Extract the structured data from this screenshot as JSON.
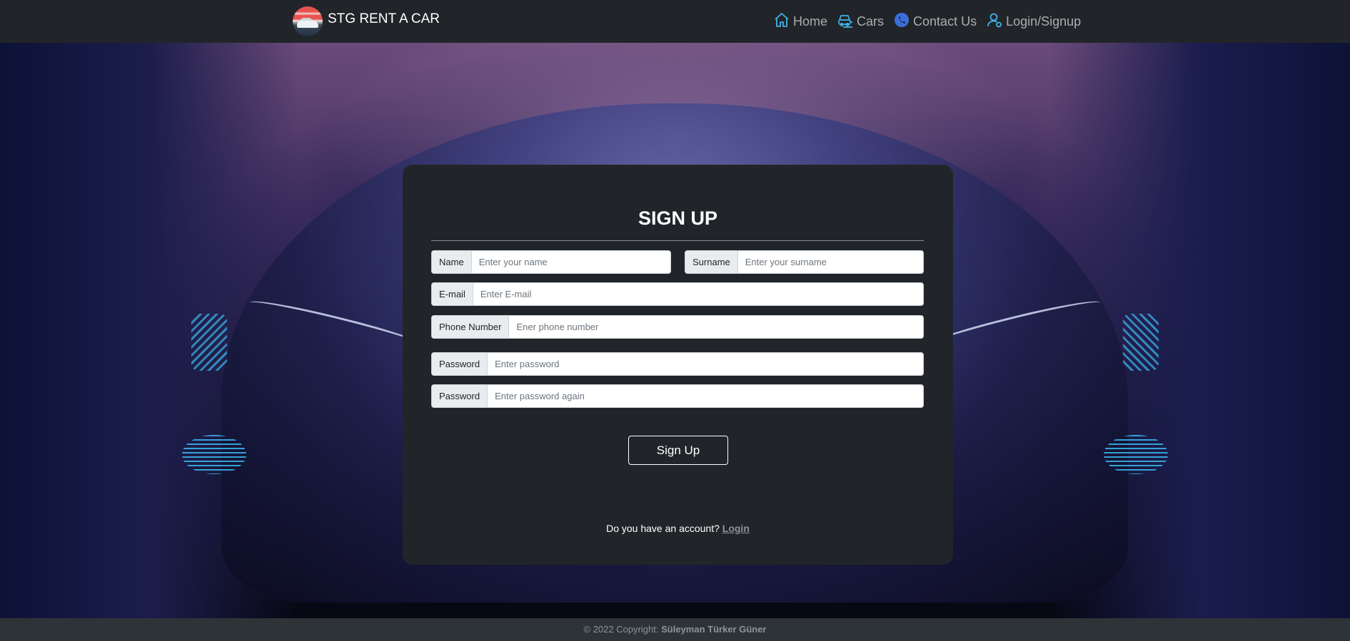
{
  "brand": {
    "name": "STG RENT A CAR"
  },
  "nav": {
    "items": [
      {
        "label": "Home",
        "icon": "home-icon"
      },
      {
        "label": "Cars",
        "icon": "car-icon"
      },
      {
        "label": "Contact Us",
        "icon": "phone-icon"
      },
      {
        "label": "Login/Signup",
        "icon": "user-icon"
      }
    ]
  },
  "form": {
    "title": "SIGN UP",
    "fields": {
      "name": {
        "label": "Name",
        "placeholder": "Enter your name"
      },
      "surname": {
        "label": "Surname",
        "placeholder": "Enter your surname"
      },
      "email": {
        "label": "E-mail",
        "placeholder": "Enter E-mail"
      },
      "phone": {
        "label": "Phone Number",
        "placeholder": "Ener phone number"
      },
      "password": {
        "label": "Password",
        "placeholder": "Enter password"
      },
      "password_again": {
        "label": "Password",
        "placeholder": "Enter password again"
      }
    },
    "submit_label": "Sign Up",
    "account_prompt": "Do you have an account?",
    "login_link": "Login"
  },
  "footer": {
    "copyright": "© 2022 Copyright:",
    "author": "Süleyman Türker Güner"
  },
  "colors": {
    "navbar": "#212529",
    "card": "#212529",
    "nav_icon": "#3fb4e8",
    "footer": "#2e3338"
  }
}
